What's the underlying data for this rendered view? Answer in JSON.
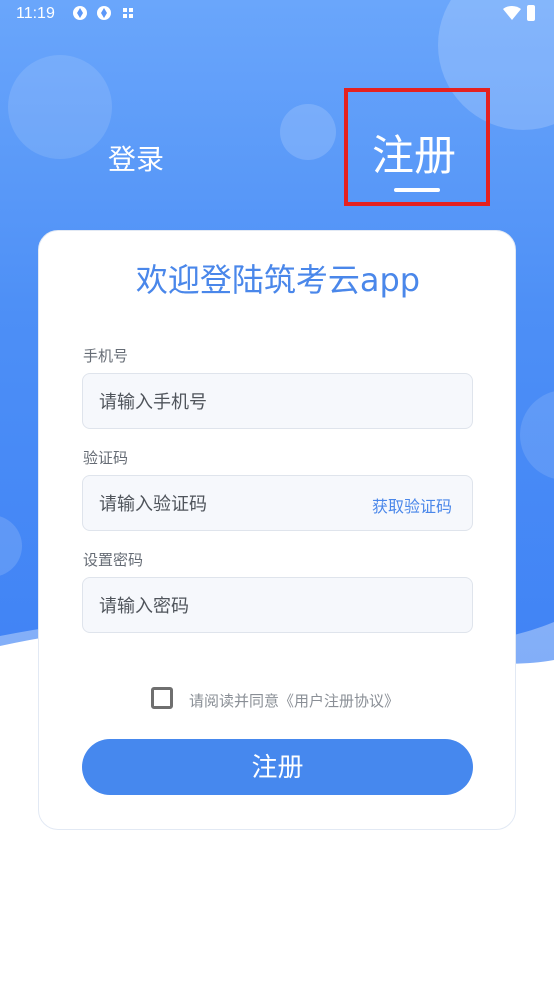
{
  "status_bar": {
    "time": "11:19",
    "icons": [
      "sync-icon",
      "sync-icon",
      "nfc-icon",
      "wifi-icon",
      "battery-icon"
    ]
  },
  "tabs": {
    "login": "登录",
    "register": "注册",
    "active": "register"
  },
  "card": {
    "welcome": "欢迎登陆筑考云app",
    "phone": {
      "label": "手机号",
      "placeholder": "请输入手机号",
      "value": ""
    },
    "code": {
      "label": "验证码",
      "placeholder": "请输入验证码",
      "value": "",
      "get_code": "获取验证码"
    },
    "password": {
      "label": "设置密码",
      "placeholder": "请输入密码",
      "value": ""
    },
    "agreement": {
      "text": "请阅读并同意《用户注册协议》",
      "checked": false
    },
    "submit": "注册"
  },
  "colors": {
    "primary": "#4688ee",
    "accent_text": "#4a87ea",
    "header_top": "#6aa6fb",
    "header_bottom": "#3f82f5",
    "highlight_border": "#e5211f"
  }
}
